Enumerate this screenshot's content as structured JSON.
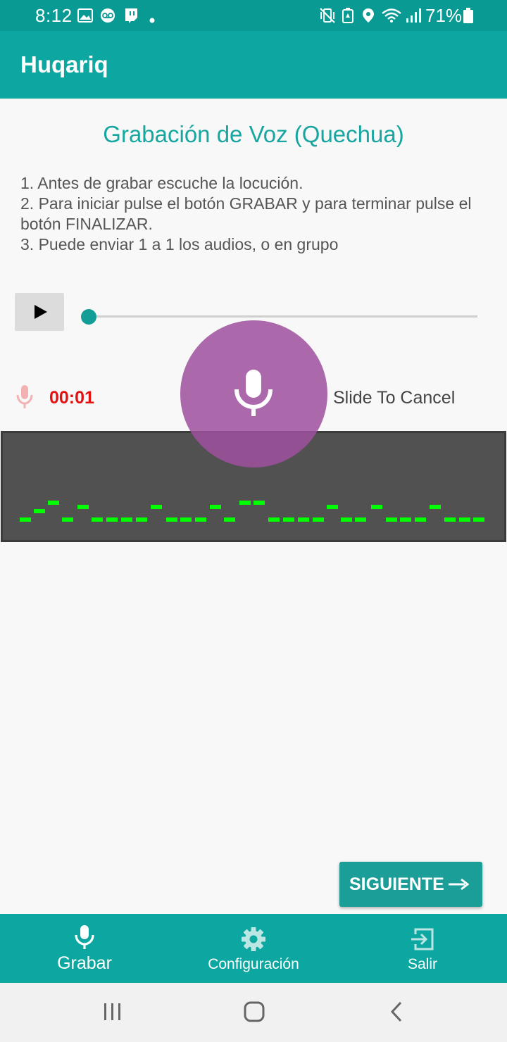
{
  "status_bar": {
    "time": "8:12",
    "battery_percent": "71%",
    "left_icons": [
      "image-icon",
      "voicemail-icon",
      "twitch-icon",
      "dot-icon"
    ],
    "right_icons": [
      "vibrate-mute-icon",
      "battery-saver-icon",
      "location-icon",
      "wifi-icon",
      "signal-icon",
      "battery-icon"
    ]
  },
  "app_bar": {
    "title": "Huqariq"
  },
  "main": {
    "title": "Grabación de Voz (Quechua)",
    "instructions": [
      "1. Antes de grabar escuche la locución.",
      "2. Para iniciar pulse el botón GRABAR y para terminar pulse el botón FINALIZAR.",
      "3. Puede enviar 1 a 1 los audios, o en grupo"
    ],
    "player": {
      "play_icon": "play-icon",
      "progress": 0
    },
    "recorder": {
      "timer": "00:01",
      "slide_hint": "Slide To Cancel",
      "mic_icon": "microphone-icon"
    },
    "next_button": {
      "label": "SIGUIENTE",
      "icon": "arrow-right-icon"
    }
  },
  "bottom_nav": {
    "items": [
      {
        "label": "Grabar",
        "icon": "microphone-icon",
        "active": true
      },
      {
        "label": "Configuración",
        "icon": "gear-icon",
        "active": false
      },
      {
        "label": "Salir",
        "icon": "exit-icon",
        "active": false
      }
    ]
  },
  "system_nav": {
    "buttons": [
      "recents-icon",
      "home-icon",
      "back-icon"
    ]
  },
  "colors": {
    "primary": "#0ba7a0",
    "accent": "#18a6a0",
    "record": "#9e509e",
    "timer": "#e31212",
    "waveform": "#00ff00"
  }
}
